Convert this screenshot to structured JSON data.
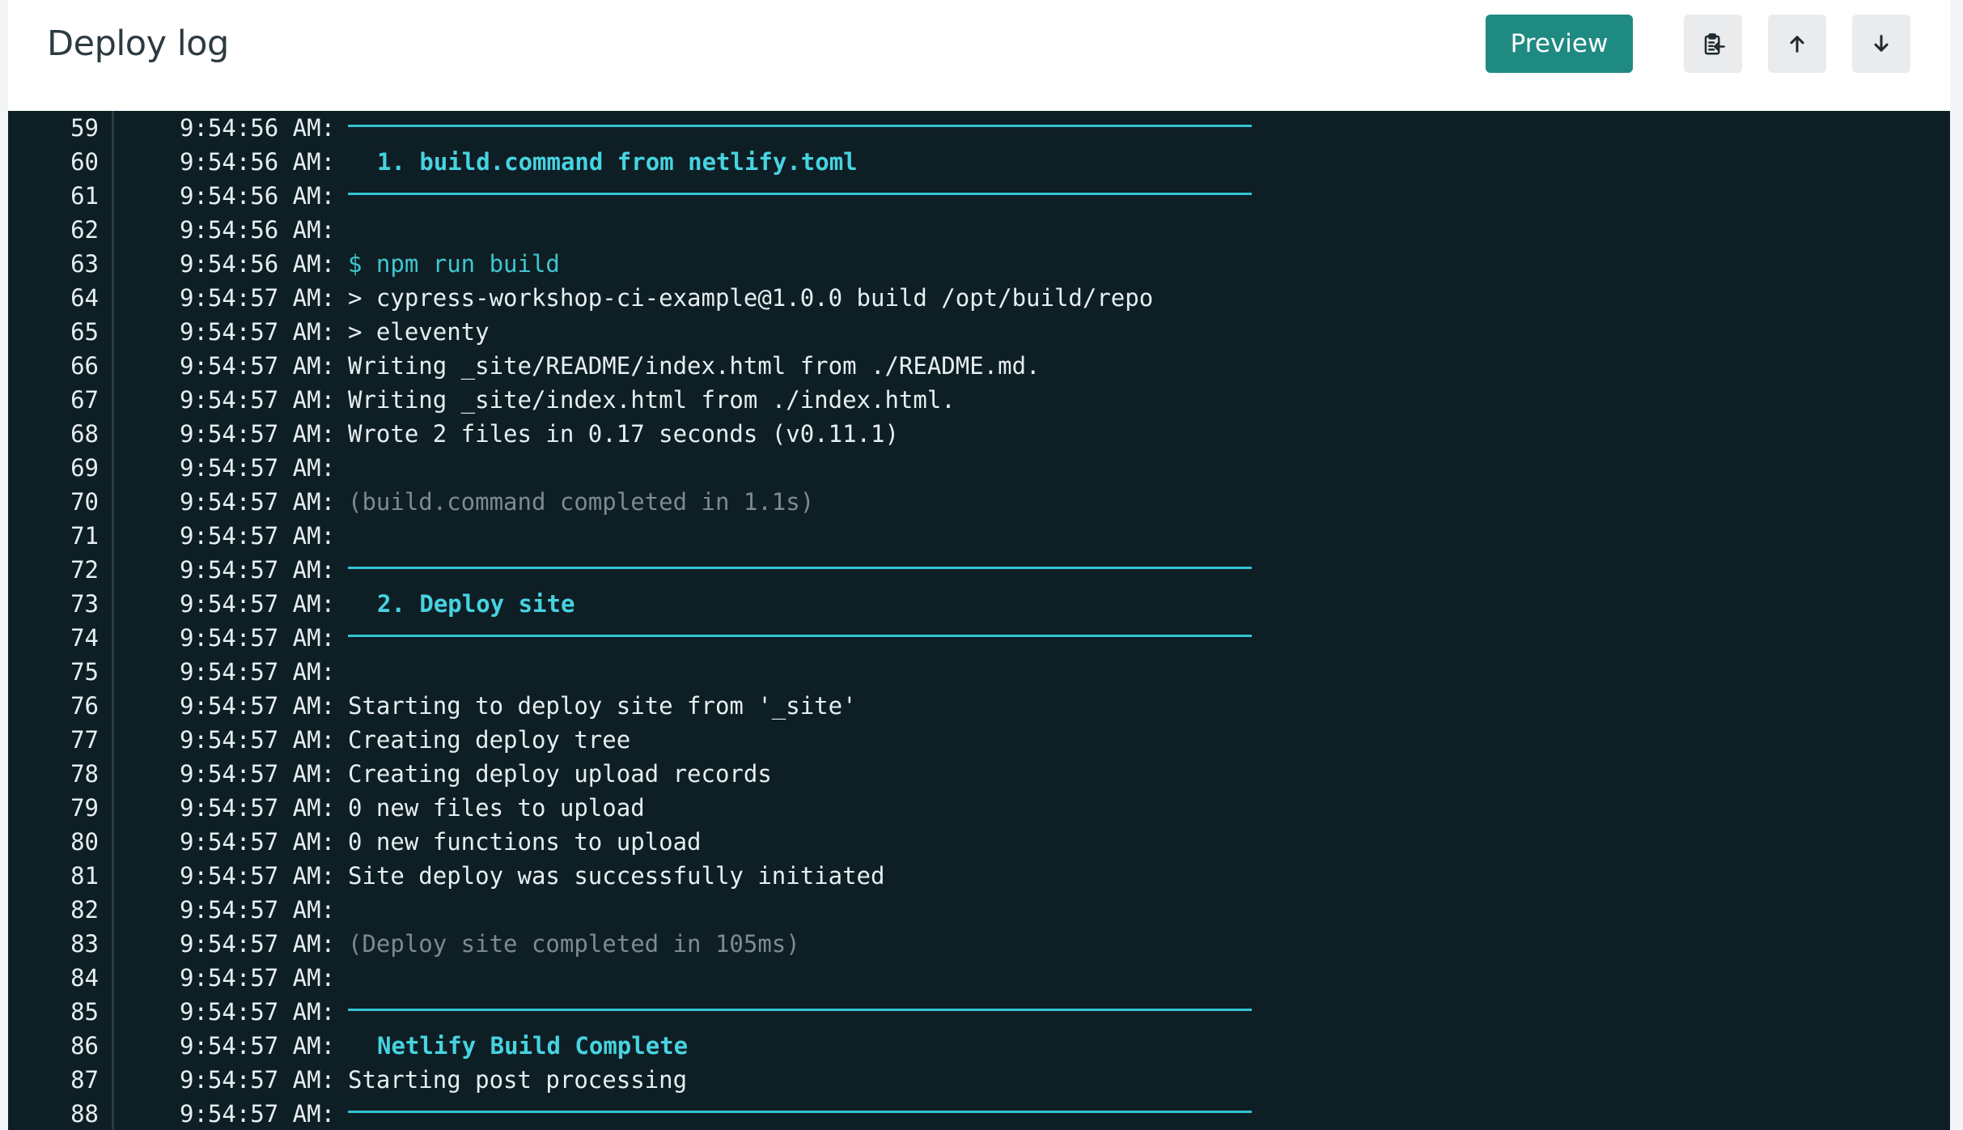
{
  "header": {
    "title": "Deploy log",
    "preview_label": "Preview",
    "icons": [
      "copy-to-clipboard-icon",
      "arrow-up-icon",
      "arrow-down-icon"
    ]
  },
  "colors": {
    "log_background": "#0e1e25",
    "accent_cyan": "#33c4d1",
    "command_cyan": "#3fc6cf",
    "muted_text": "#7d8a90",
    "preview_button": "#1f8a82"
  },
  "log_lines": [
    {
      "n": "59",
      "time": "9:54:56 AM:",
      "kind": "rule",
      "text": ""
    },
    {
      "n": "60",
      "time": "9:54:56 AM:",
      "kind": "header",
      "text": "1. build.command from netlify.toml"
    },
    {
      "n": "61",
      "time": "9:54:56 AM:",
      "kind": "rule",
      "text": ""
    },
    {
      "n": "62",
      "time": "9:54:56 AM:",
      "kind": "normal",
      "text": ""
    },
    {
      "n": "63",
      "time": "9:54:56 AM:",
      "kind": "command",
      "text": "$ npm run build"
    },
    {
      "n": "64",
      "time": "9:54:57 AM:",
      "kind": "normal",
      "text": "> cypress-workshop-ci-example@1.0.0 build /opt/build/repo"
    },
    {
      "n": "65",
      "time": "9:54:57 AM:",
      "kind": "normal",
      "text": "> eleventy"
    },
    {
      "n": "66",
      "time": "9:54:57 AM:",
      "kind": "normal",
      "text": "Writing _site/README/index.html from ./README.md."
    },
    {
      "n": "67",
      "time": "9:54:57 AM:",
      "kind": "normal",
      "text": "Writing _site/index.html from ./index.html."
    },
    {
      "n": "68",
      "time": "9:54:57 AM:",
      "kind": "normal",
      "text": "Wrote 2 files in 0.17 seconds (v0.11.1)"
    },
    {
      "n": "69",
      "time": "9:54:57 AM:",
      "kind": "normal",
      "text": ""
    },
    {
      "n": "70",
      "time": "9:54:57 AM:",
      "kind": "dim",
      "text": "(build.command completed in 1.1s)"
    },
    {
      "n": "71",
      "time": "9:54:57 AM:",
      "kind": "normal",
      "text": ""
    },
    {
      "n": "72",
      "time": "9:54:57 AM:",
      "kind": "rule",
      "text": ""
    },
    {
      "n": "73",
      "time": "9:54:57 AM:",
      "kind": "header",
      "text": "2. Deploy site"
    },
    {
      "n": "74",
      "time": "9:54:57 AM:",
      "kind": "rule",
      "text": ""
    },
    {
      "n": "75",
      "time": "9:54:57 AM:",
      "kind": "normal",
      "text": ""
    },
    {
      "n": "76",
      "time": "9:54:57 AM:",
      "kind": "normal",
      "text": "Starting to deploy site from '_site'"
    },
    {
      "n": "77",
      "time": "9:54:57 AM:",
      "kind": "normal",
      "text": "Creating deploy tree"
    },
    {
      "n": "78",
      "time": "9:54:57 AM:",
      "kind": "normal",
      "text": "Creating deploy upload records"
    },
    {
      "n": "79",
      "time": "9:54:57 AM:",
      "kind": "normal",
      "text": "0 new files to upload"
    },
    {
      "n": "80",
      "time": "9:54:57 AM:",
      "kind": "normal",
      "text": "0 new functions to upload"
    },
    {
      "n": "81",
      "time": "9:54:57 AM:",
      "kind": "normal",
      "text": "Site deploy was successfully initiated"
    },
    {
      "n": "82",
      "time": "9:54:57 AM:",
      "kind": "normal",
      "text": ""
    },
    {
      "n": "83",
      "time": "9:54:57 AM:",
      "kind": "dim",
      "text": "(Deploy site completed in 105ms)"
    },
    {
      "n": "84",
      "time": "9:54:57 AM:",
      "kind": "normal",
      "text": ""
    },
    {
      "n": "85",
      "time": "9:54:57 AM:",
      "kind": "rule",
      "text": ""
    },
    {
      "n": "86",
      "time": "9:54:57 AM:",
      "kind": "header",
      "text": "Netlify Build Complete"
    },
    {
      "n": "87",
      "time": "9:54:57 AM:",
      "kind": "normal",
      "text": "Starting post processing"
    },
    {
      "n": "88",
      "time": "9:54:57 AM:",
      "kind": "rule",
      "text": ""
    }
  ]
}
